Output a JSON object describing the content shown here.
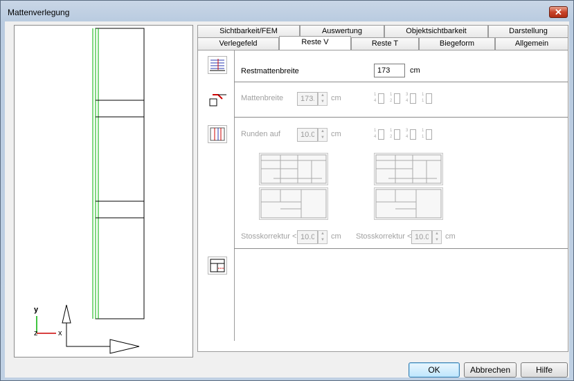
{
  "window": {
    "title": "Mattenverlegung"
  },
  "tabs_row1": [
    "Sichtbarkeit/FEM",
    "Auswertung",
    "Objektsichtbarkeit",
    "Darstellung"
  ],
  "tabs_row2": [
    "Verlegefeld",
    "Reste V",
    "Reste T",
    "Biegeform",
    "Allgemein"
  ],
  "active_tab": "Reste V",
  "section1": {
    "label": "Restmattenbreite",
    "value": "173",
    "unit": "cm"
  },
  "section2": {
    "label": "Mattenbreite",
    "value": "173.",
    "unit": "cm",
    "fractions": [
      "1/4",
      "1/2",
      "3/4",
      "1/1"
    ]
  },
  "section3": {
    "label": "Runden auf",
    "value": "10.0",
    "unit": "cm",
    "fractions": [
      "1/4",
      "1/2",
      "3/4",
      "1/1"
    ],
    "stoss_left": {
      "label": "Stosskorrektur <",
      "value": "10.0",
      "unit": "cm"
    },
    "stoss_right": {
      "label": "Stosskorrektur <",
      "value": "10.0",
      "unit": "cm"
    }
  },
  "axes": {
    "y": "y",
    "z": "z",
    "x": "x"
  },
  "buttons": {
    "ok": "OK",
    "cancel": "Abbrechen",
    "help": "Hilfe"
  }
}
